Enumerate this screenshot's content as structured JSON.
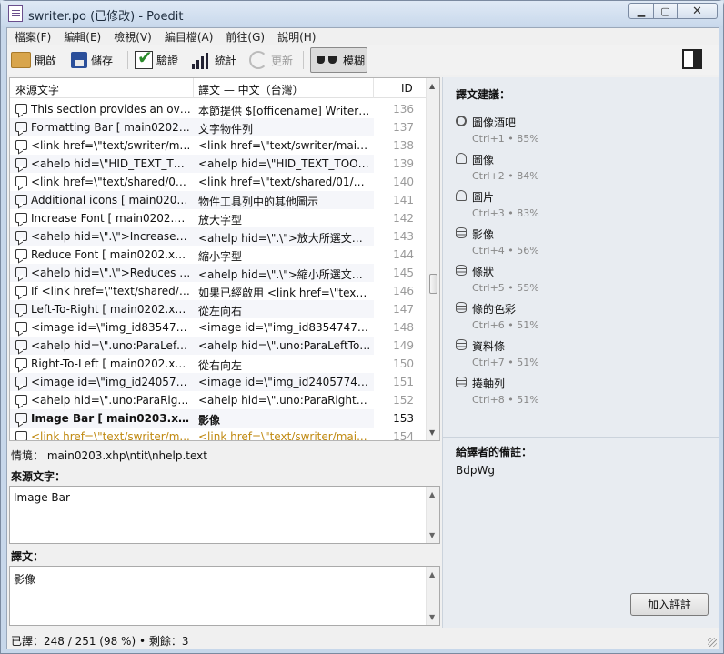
{
  "window": {
    "title": "swriter.po (已修改) - Poedit"
  },
  "menu": [
    "檔案(F)",
    "編輯(E)",
    "檢視(V)",
    "編目檔(A)",
    "前往(G)",
    "說明(H)"
  ],
  "toolbar": {
    "open": "開啟",
    "save": "儲存",
    "validate": "驗證",
    "stats": "統計",
    "update": "更新",
    "fuzzy": "模糊"
  },
  "list": {
    "columns": {
      "source": "來源文字",
      "translation": "譯文 — 中文（台灣）",
      "id": "ID"
    },
    "rows": [
      {
        "source": "This section provides an over...",
        "translation": "本節提供 $[officename] Writer ...",
        "id": "136"
      },
      {
        "source": "Formatting Bar  [ main0202.x...",
        "translation": "文字物件列",
        "id": "137"
      },
      {
        "source": "<link href=\\\"text/swriter/mai...",
        "translation": "<link href=\\\"text/swriter/main0...",
        "id": "138"
      },
      {
        "source": "<ahelp hid=\\\"HID_TEXT_TO...",
        "translation": "<ahelp hid=\\\"HID_TEXT_TOOL...",
        "id": "139"
      },
      {
        "source": "<link href=\\\"text/shared/01/...",
        "translation": "<link href=\\\"text/shared/01/05...",
        "id": "140"
      },
      {
        "source": "Additional icons  [ main0202....",
        "translation": "物件工具列中的其他圖示",
        "id": "141"
      },
      {
        "source": "Increase Font  [ main0202.xh...",
        "translation": "放大字型",
        "id": "142"
      },
      {
        "source": "<ahelp hid=\\\".\\\">Increases t...",
        "translation": "<ahelp hid=\\\".\\\">放大所選文字...",
        "id": "143"
      },
      {
        "source": "Reduce Font  [ main0202.xhp...",
        "translation": "縮小字型",
        "id": "144"
      },
      {
        "source": "<ahelp hid=\\\".\\\">Reduces th...",
        "translation": "<ahelp hid=\\\".\\\">縮小所選文字...",
        "id": "145"
      },
      {
        "source": "If <link href=\\\"text/shared/00...",
        "translation": "如果已經啟用 <link href=\\\"text/s...",
        "id": "146"
      },
      {
        "source": "Left-To-Right  [ main0202.xh...",
        "translation": "從左向右",
        "id": "147"
      },
      {
        "source": "<image id=\\\"img_id8354747...",
        "translation": "<image id=\\\"img_id8354747\\\" ...",
        "id": "148"
      },
      {
        "source": "<ahelp hid=\\\".uno:ParaLeftT...",
        "translation": "<ahelp hid=\\\".uno:ParaLeftToR...",
        "id": "149"
      },
      {
        "source": "Right-To-Left  [ main0202.xh...",
        "translation": "從右向左",
        "id": "150"
      },
      {
        "source": "<image id=\\\"img_id2405774...",
        "translation": "<image id=\\\"img_id2405774\\\" ...",
        "id": "151"
      },
      {
        "source": "<ahelp hid=\\\".uno:ParaRight...",
        "translation": "<ahelp hid=\\\".uno:ParaRightTo...",
        "id": "152"
      },
      {
        "source": "Image Bar  [ main0203.xhp\\...",
        "translation": "影像",
        "id": "153"
      },
      {
        "source": "<link href=\\\"text/swriter/m...",
        "translation": "<link href=\\\"text/swriter/mai...",
        "id": "154"
      }
    ]
  },
  "context": {
    "label": "情境：",
    "value": "main0203.xhp\\ntit\\nhelp.text"
  },
  "source_label": "來源文字：",
  "source_text": "Image Bar",
  "translation_label": "譯文：",
  "translation_text": "影像",
  "side": {
    "suggestions_title": "譯文建議：",
    "suggestions": [
      {
        "text": "圖像酒吧",
        "meta": "Ctrl+1 • 85%",
        "icon": "gear-icon"
      },
      {
        "text": "圖像",
        "meta": "Ctrl+2 • 84%",
        "icon": "person-icon"
      },
      {
        "text": "圖片",
        "meta": "Ctrl+3 • 83%",
        "icon": "person-icon"
      },
      {
        "text": "影像",
        "meta": "Ctrl+4 • 56%",
        "icon": "database-icon"
      },
      {
        "text": "條狀",
        "meta": "Ctrl+5 • 55%",
        "icon": "database-icon"
      },
      {
        "text": "條的色彩",
        "meta": "Ctrl+6 • 51%",
        "icon": "database-icon"
      },
      {
        "text": "資料條",
        "meta": "Ctrl+7 • 51%",
        "icon": "database-icon"
      },
      {
        "text": "捲軸列",
        "meta": "Ctrl+8 • 51%",
        "icon": "database-icon"
      }
    ],
    "notes_title": "給譯者的備註：",
    "notes_value": "BdpWg",
    "add_comment": "加入評註"
  },
  "status": "已譯：248 / 251 (98 %) • 剩餘：3"
}
